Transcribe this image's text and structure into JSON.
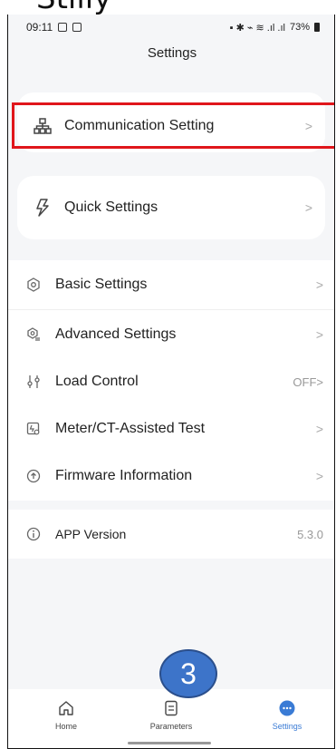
{
  "overlay": {
    "cropped_text": "Stilly",
    "step_number": "3"
  },
  "status_bar": {
    "time": "09:11",
    "right_text": "73%"
  },
  "header": {
    "title": "Settings"
  },
  "communication": {
    "label": "Communication Setting",
    "chevron": ">"
  },
  "quick": {
    "label": "Quick Settings",
    "chevron": ">"
  },
  "settings_list": [
    {
      "label": "Basic Settings",
      "value": ">",
      "icon": "gear-icon"
    },
    {
      "label": "Advanced Settings",
      "value": ">",
      "icon": "advanced-gear-icon"
    },
    {
      "label": "Load Control",
      "value": "OFF>",
      "icon": "sliders-icon"
    },
    {
      "label": "Meter/CT-Assisted Test",
      "value": ">",
      "icon": "meter-test-icon"
    },
    {
      "label": "Firmware Information",
      "value": ">",
      "icon": "firmware-icon"
    }
  ],
  "app_version": {
    "label": "APP Version",
    "value": "5.3.0"
  },
  "bottom_nav": {
    "items": [
      {
        "label": "Home",
        "icon": "home-icon",
        "active": false
      },
      {
        "label": "Parameters",
        "icon": "parameters-icon",
        "active": false
      },
      {
        "label": "Settings",
        "icon": "settings-dots-icon",
        "active": true
      }
    ]
  },
  "colors": {
    "accent": "#3a7bd5",
    "highlight": "#e0161b",
    "badge": "#3d74c9"
  }
}
